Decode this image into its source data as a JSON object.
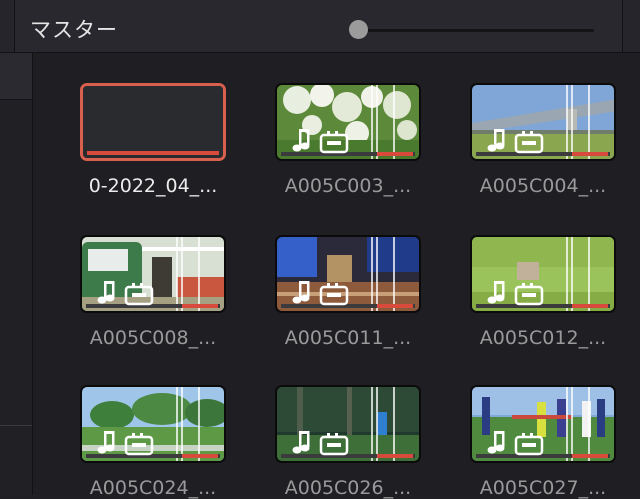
{
  "header": {
    "title": "マスター"
  },
  "clips": [
    {
      "name": "0-2022_04_...",
      "selected": true,
      "scene": "blank"
    },
    {
      "name": "A005C003_...",
      "selected": false,
      "scene": "flowers"
    },
    {
      "name": "A005C004_...",
      "selected": false,
      "scene": "bridge"
    },
    {
      "name": "A005C008_...",
      "selected": false,
      "scene": "van"
    },
    {
      "name": "A005C011_...",
      "selected": false,
      "scene": "table"
    },
    {
      "name": "A005C012_...",
      "selected": false,
      "scene": "grass"
    },
    {
      "name": "A005C024_...",
      "selected": false,
      "scene": "park"
    },
    {
      "name": "A005C026_...",
      "selected": false,
      "scene": "forest"
    },
    {
      "name": "A005C027_...",
      "selected": false,
      "scene": "players"
    }
  ],
  "colors": {
    "selection_border": "#d8604c",
    "audio_bar": "#d84b3c",
    "background": "#1e1e23"
  }
}
